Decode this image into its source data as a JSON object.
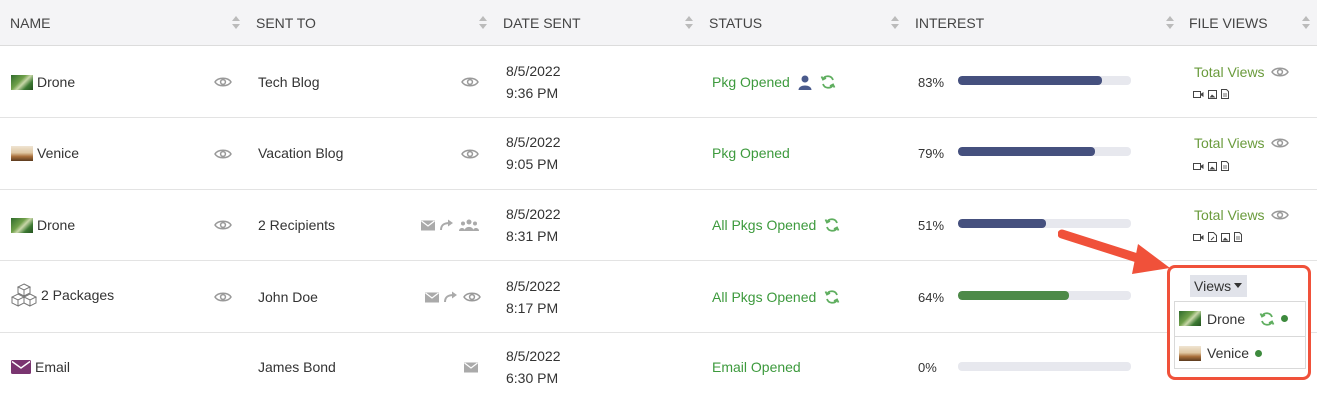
{
  "table": {
    "headers": [
      "NAME",
      "SENT TO",
      "DATE SENT",
      "STATUS",
      "INTEREST",
      "FILE VIEWS"
    ],
    "rows": [
      {
        "name": "Drone",
        "thumb": "drone-thumbnail",
        "sent_to": "Tech Blog",
        "date": "8/5/2022",
        "time": "9:36 PM",
        "status": "Pkg Opened",
        "interest_pct": "83%",
        "interest_value": 0.83,
        "interest_color": "#45507e",
        "file_views": "Total Views"
      },
      {
        "name": "Venice",
        "thumb": "venice-thumbnail",
        "sent_to": "Vacation Blog",
        "date": "8/5/2022",
        "time": "9:05 PM",
        "status": "Pkg Opened",
        "interest_pct": "79%",
        "interest_value": 0.79,
        "interest_color": "#45507e",
        "file_views": "Total Views"
      },
      {
        "name": "Drone",
        "thumb": "drone-thumbnail",
        "sent_to": "2 Recipients",
        "date": "8/5/2022",
        "time": "8:31 PM",
        "status": "All Pkgs Opened",
        "interest_pct": "51%",
        "interest_value": 0.51,
        "interest_color": "#45507e",
        "file_views": "Total Views"
      },
      {
        "name": "2 Packages",
        "thumb": "packages-icon",
        "sent_to": "John Doe",
        "date": "8/5/2022",
        "time": "8:17 PM",
        "status": "All Pkgs Opened",
        "interest_pct": "64%",
        "interest_value": 0.64,
        "interest_color": "#4d8a48",
        "file_views": "Views"
      },
      {
        "name": "Email",
        "thumb": "email-icon",
        "sent_to": "James Bond",
        "date": "8/5/2022",
        "time": "6:30 PM",
        "status": "Email Opened",
        "interest_pct": "0%",
        "interest_value": 0.0,
        "interest_color": "#45507e",
        "file_views": ""
      }
    ]
  },
  "views_dropdown": {
    "label": "Views",
    "items": [
      {
        "name": "Drone"
      },
      {
        "name": "Venice"
      }
    ]
  },
  "colors": {
    "status_green": "#3d9a3d",
    "total_views_green": "#6a9b3c",
    "bar_blue": "#45507e",
    "bar_green": "#4d8a48",
    "highlight_red": "#f0513a"
  }
}
